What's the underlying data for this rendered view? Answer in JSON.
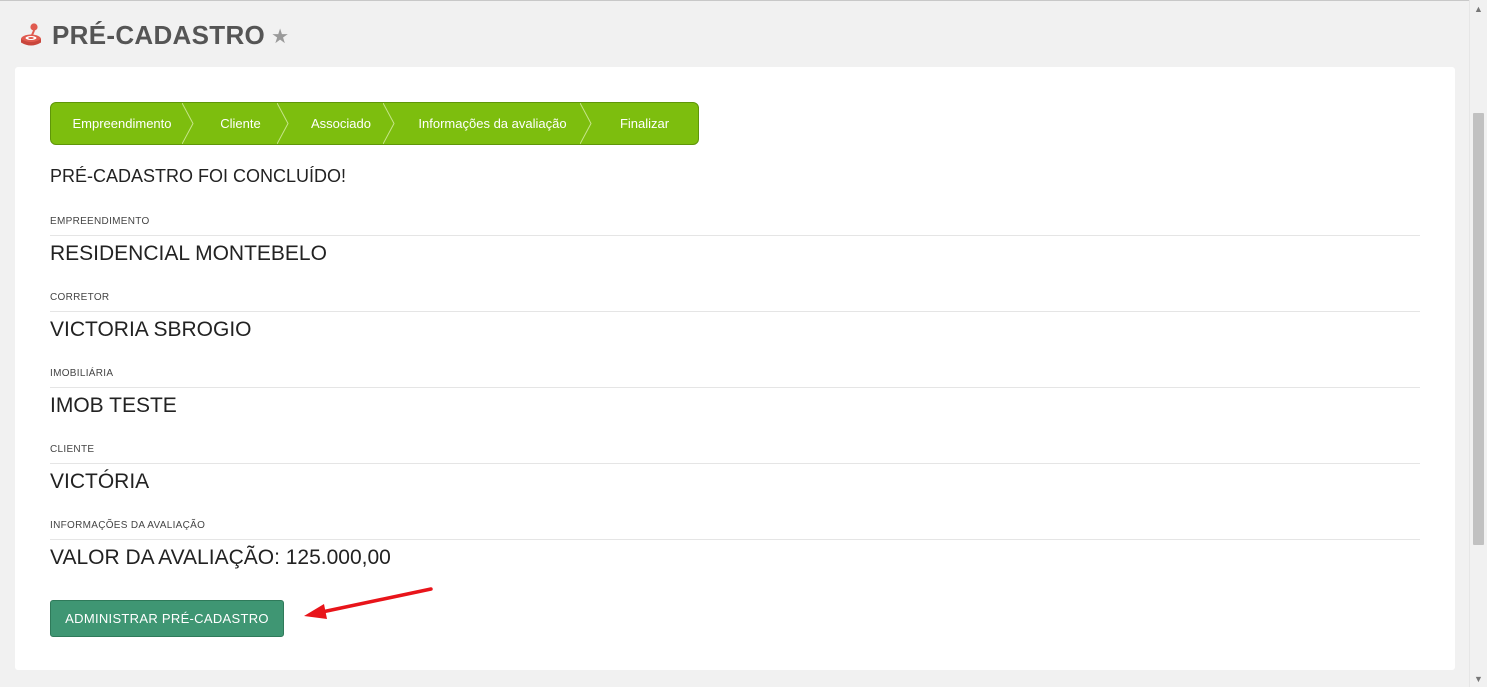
{
  "header": {
    "title": "PRÉ-CADASTRO",
    "icon": "joystick-icon",
    "star_icon": "star-icon"
  },
  "wizard": {
    "steps": [
      {
        "label": "Empreendimento"
      },
      {
        "label": "Cliente"
      },
      {
        "label": "Associado"
      },
      {
        "label": "Informações da avaliação"
      },
      {
        "label": "Finalizar"
      }
    ],
    "color": "#7dbe0e"
  },
  "status_message": "PRÉ-CADASTRO FOI CONCLUÍDO!",
  "fields": [
    {
      "label": "EMPREENDIMENTO",
      "value": "RESIDENCIAL MONTEBELO"
    },
    {
      "label": "CORRETOR",
      "value": "VICTORIA SBROGIO"
    },
    {
      "label": "IMOBILIÁRIA",
      "value": "IMOB TESTE"
    },
    {
      "label": "CLIENTE",
      "value": "VICTÓRIA"
    },
    {
      "label": "INFORMAÇÕES DA AVALIAÇÃO",
      "value": "VALOR DA AVALIAÇÃO: 125.000,00"
    }
  ],
  "actions": {
    "admin_button_label": "ADMINISTRAR PRÉ-CADASTRO",
    "button_color": "#3f9673"
  },
  "annotation": {
    "arrow_color": "#e8141a"
  }
}
